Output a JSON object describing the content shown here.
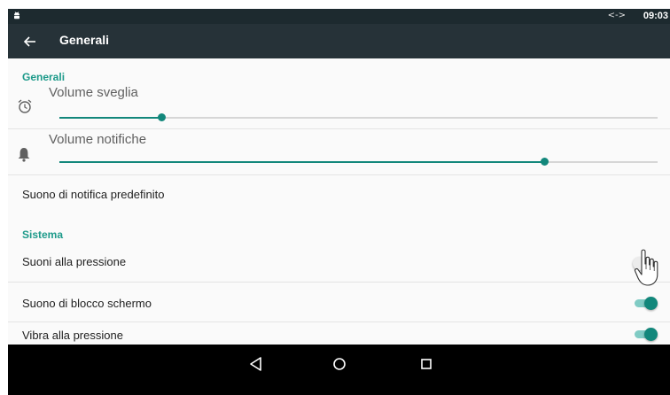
{
  "status_bar": {
    "app_icon": "android-robot-icon",
    "network_icon_glyph": "<->",
    "time": "09:03"
  },
  "toolbar": {
    "back_icon": "arrow-back-icon",
    "title": "Generali"
  },
  "sections": {
    "generali": {
      "header": "Generali",
      "alarm_volume": {
        "label": "Volume sveglia",
        "icon": "alarm-clock-icon",
        "value_fraction": 0.17
      },
      "notification_volume": {
        "label": "Volume notifiche",
        "icon": "bell-icon",
        "value_fraction": 0.81
      },
      "default_notification_sound": {
        "label": "Suono di notifica predefinito"
      }
    },
    "sistema": {
      "header": "Sistema",
      "touch_sounds": {
        "label": "Suoni alla pressione",
        "enabled": false
      },
      "screen_lock_sound": {
        "label": "Suono di blocco schermo",
        "enabled": true
      },
      "vibrate_on_touch": {
        "label": "Vibra alla pressione",
        "enabled": true
      }
    }
  },
  "navigation_bar": {
    "back": "nav-back-triangle-icon",
    "home": "nav-home-circle-icon",
    "recents": "nav-recents-square-icon"
  },
  "colors": {
    "accent": "#12877b",
    "section_header": "#1d9a8a",
    "toolbar": "#263238",
    "status_bar": "#1d2a2f"
  }
}
